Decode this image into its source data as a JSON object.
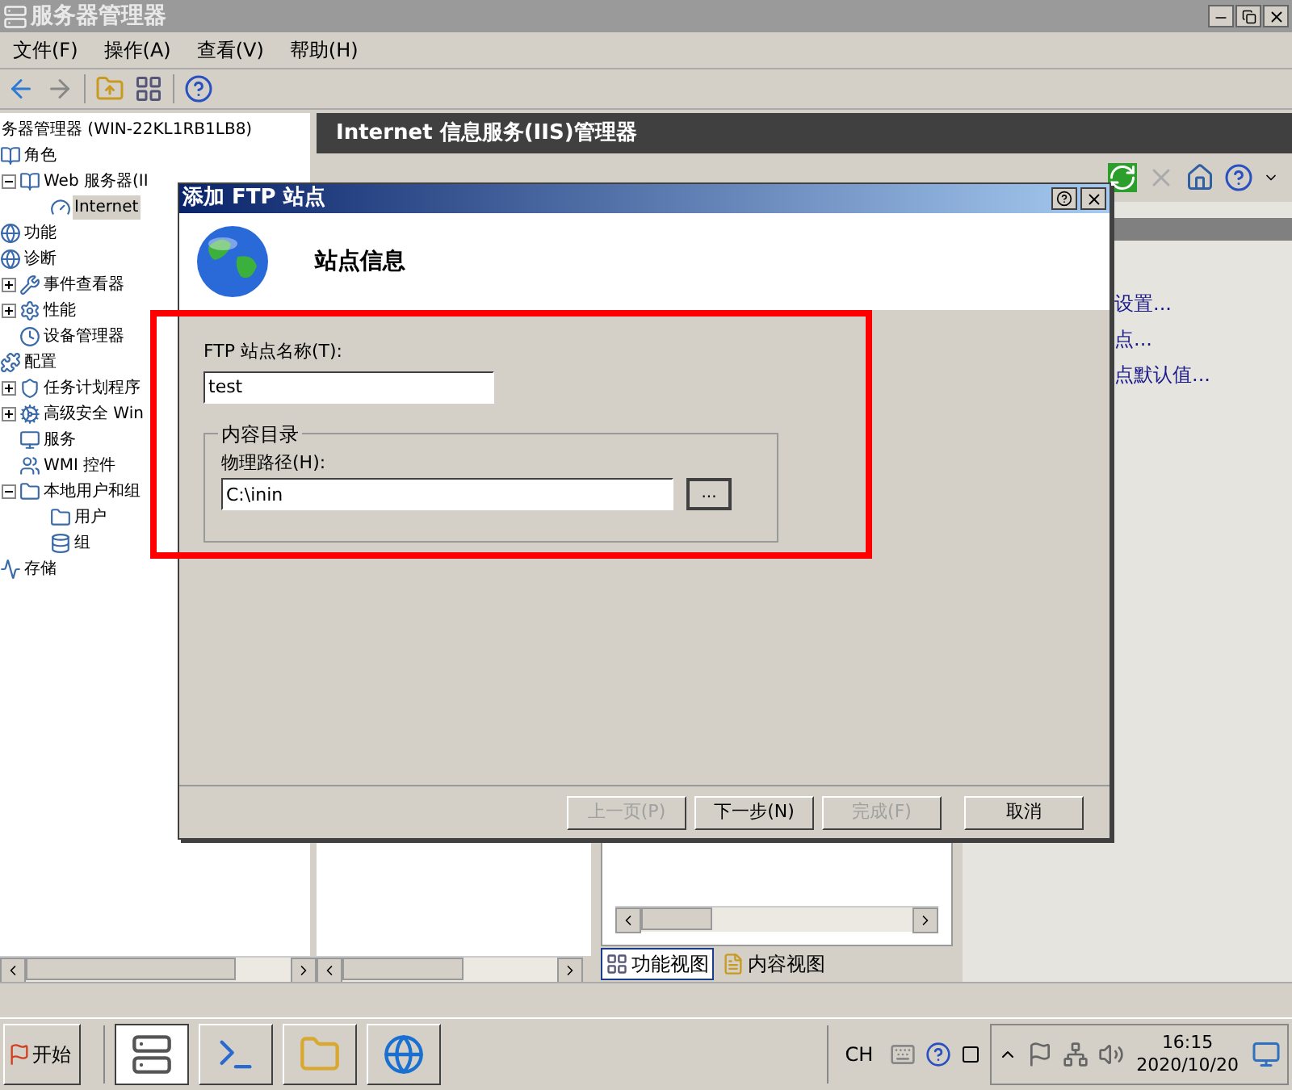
{
  "window": {
    "title": "服务器管理器"
  },
  "menu": [
    "文件(F)",
    "操作(A)",
    "查看(V)",
    "帮助(H)"
  ],
  "tree": [
    {
      "label": "务器管理器 (WIN-22KL1RB1LB8)",
      "selected": false,
      "children": [
        {
          "label": "角色",
          "selected": false,
          "children": [
            {
              "label": "Web 服务器(II",
              "selected": false,
              "expanded": true,
              "children": [
                {
                  "label": "Internet",
                  "selected": true
                }
              ]
            }
          ]
        },
        {
          "label": "功能",
          "selected": false
        },
        {
          "label": "诊断",
          "selected": false,
          "children": [
            {
              "label": "事件查看器",
              "selected": false,
              "expanded": false
            },
            {
              "label": "性能",
              "selected": false,
              "expanded": false
            },
            {
              "label": "设备管理器",
              "selected": false
            }
          ]
        },
        {
          "label": "配置",
          "selected": false,
          "children": [
            {
              "label": "任务计划程序",
              "selected": false,
              "expanded": false
            },
            {
              "label": "高级安全 Win",
              "selected": false,
              "expanded": false
            },
            {
              "label": "服务",
              "selected": false
            },
            {
              "label": "WMI 控件",
              "selected": false
            },
            {
              "label": "本地用户和组",
              "selected": false,
              "expanded": true,
              "children": [
                {
                  "label": "用户",
                  "selected": false
                },
                {
                  "label": "组",
                  "selected": false
                }
              ]
            }
          ]
        },
        {
          "label": "存储",
          "selected": false
        }
      ]
    }
  ],
  "content": {
    "header": "Internet 信息服务(IIS)管理器",
    "actions": [
      "设置...",
      "点...",
      "点默认值..."
    ],
    "view_tabs": [
      {
        "label": "功能视图",
        "selected": true
      },
      {
        "label": "内容视图",
        "selected": false
      }
    ]
  },
  "dialog": {
    "title": "添加 FTP 站点",
    "heading": "站点信息",
    "site_name_label": "FTP 站点名称(T):",
    "site_name": "test",
    "group_label": "内容目录",
    "path_label": "物理路径(H):",
    "path": "C:\\inin",
    "browse": "...",
    "buttons": [
      {
        "label": "上一页(P)",
        "disabled": true
      },
      {
        "label": "下一步(N)",
        "disabled": false
      },
      {
        "label": "完成(F)",
        "disabled": true
      },
      {
        "label": "取消",
        "disabled": false
      }
    ]
  },
  "taskbar": {
    "start": "开始",
    "apps": [
      {
        "selected": true
      },
      {
        "selected": false
      },
      {
        "selected": false
      },
      {
        "selected": false
      }
    ],
    "language": "CH",
    "time": "16:15",
    "date": "2020/10/20"
  }
}
